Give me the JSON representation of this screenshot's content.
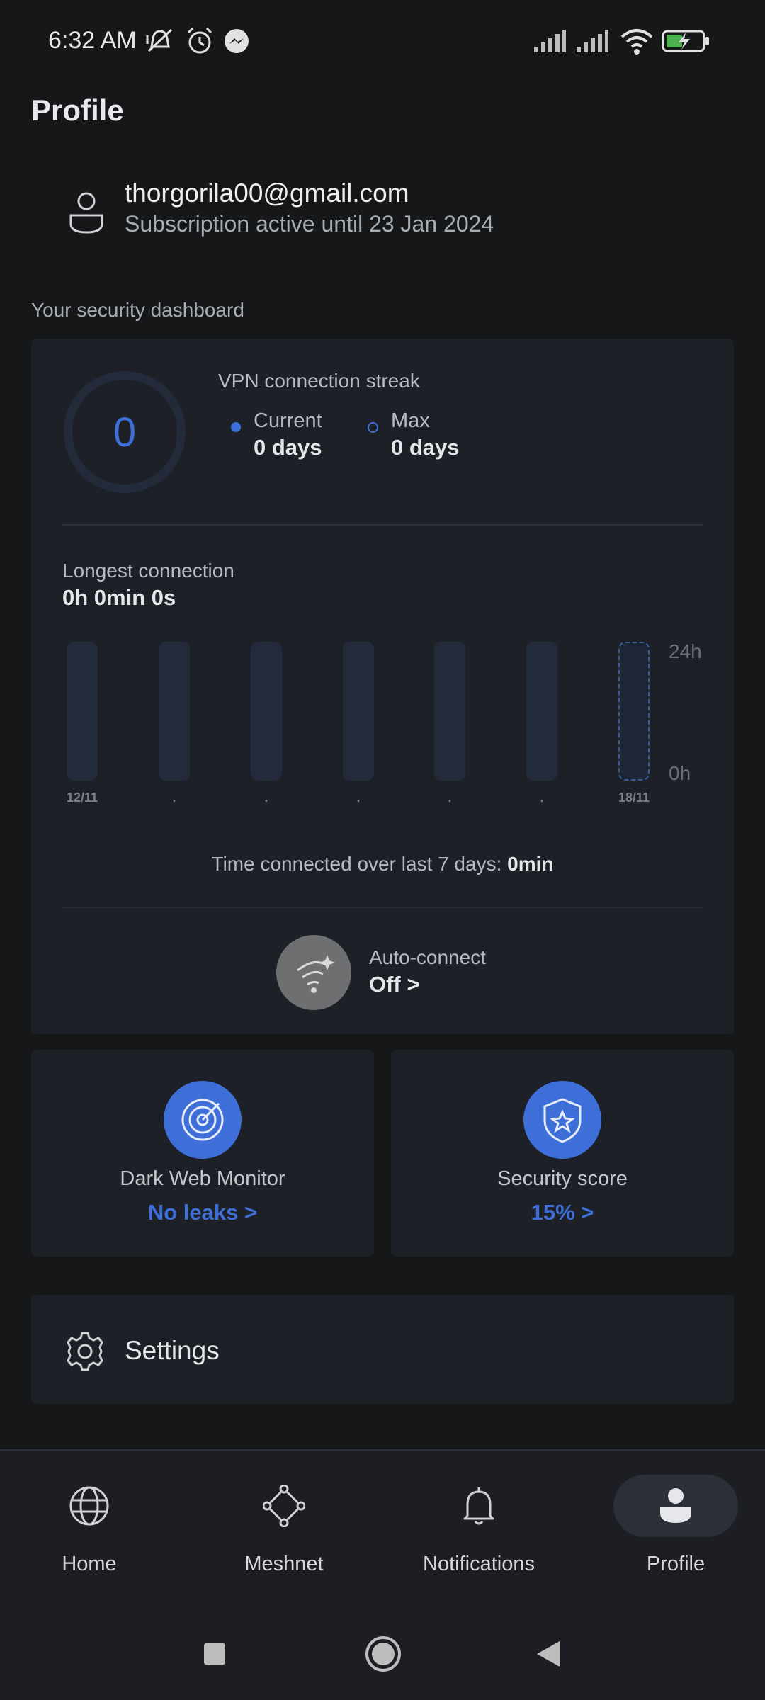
{
  "status_bar": {
    "time": "6:32 AM",
    "icons": [
      "mute-icon",
      "alarm-icon",
      "messenger-icon",
      "signal-icon",
      "signal-icon",
      "wifi-icon",
      "battery-charging-icon"
    ]
  },
  "page": {
    "title": "Profile"
  },
  "account": {
    "email": "thorgorila00@gmail.com",
    "subscription": "Subscription active until 23 Jan 2024"
  },
  "dashboard": {
    "section_label": "Your security dashboard",
    "streak": {
      "value": "0",
      "title": "VPN connection streak",
      "current_label": "Current",
      "current_value": "0 days",
      "max_label": "Max",
      "max_value": "0 days"
    },
    "longest": {
      "label": "Longest connection",
      "value": "0h 0min 0s"
    },
    "weekly_label": "Time connected over last 7 days: ",
    "weekly_value": "0min",
    "auto_connect": {
      "label": "Auto-connect",
      "value": "Off >"
    }
  },
  "chart_data": {
    "type": "bar",
    "categories": [
      "12/11",
      ".",
      ".",
      ".",
      ".",
      ".",
      "18/11"
    ],
    "values": [
      0,
      0,
      0,
      0,
      0,
      0,
      0
    ],
    "y_tick_top": "24h",
    "y_tick_bottom": "0h",
    "ylim": [
      0,
      24
    ]
  },
  "dark_web": {
    "title": "Dark Web Monitor",
    "value": "No leaks >"
  },
  "security_score": {
    "title": "Security score",
    "value": "15% >"
  },
  "settings": {
    "label": "Settings"
  },
  "nav": {
    "home": "Home",
    "meshnet": "Meshnet",
    "notifications": "Notifications",
    "profile": "Profile"
  },
  "colors": {
    "accent": "#3e6fd8",
    "card": "#1d2027",
    "background": "#161718"
  }
}
